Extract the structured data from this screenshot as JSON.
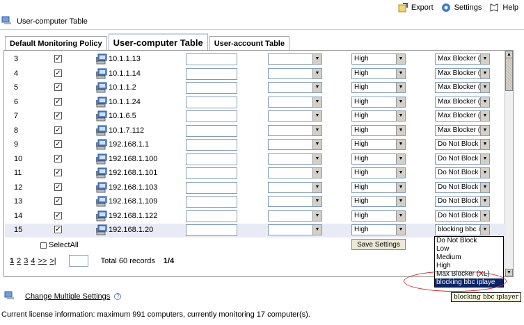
{
  "toolbar": {
    "export": "Export",
    "settings": "Settings",
    "help": "Help"
  },
  "page_title": "User-computer Table",
  "tabs": [
    "Default Monitoring Policy",
    "User-computer Table",
    "User-account Table"
  ],
  "rows": [
    {
      "num": "3",
      "checked": true,
      "ip": "10.1.1.13",
      "level": "High",
      "policy": "Max Blocker (X"
    },
    {
      "num": "4",
      "checked": true,
      "ip": "10.1.1.14",
      "level": "High",
      "policy": "Max Blocker (X"
    },
    {
      "num": "5",
      "checked": true,
      "ip": "10.1.1.2",
      "level": "High",
      "policy": "Max Blocker (X"
    },
    {
      "num": "6",
      "checked": true,
      "ip": "10.1.1.24",
      "level": "High",
      "policy": "Max Blocker (X"
    },
    {
      "num": "7",
      "checked": true,
      "ip": "10.1.6.5",
      "level": "High",
      "policy": "Max Blocker (X"
    },
    {
      "num": "8",
      "checked": true,
      "ip": "10.1.7.112",
      "level": "High",
      "policy": "Max Blocker (X"
    },
    {
      "num": "9",
      "checked": true,
      "ip": "192.168.1.1",
      "level": "High",
      "policy": "Do Not Block"
    },
    {
      "num": "10",
      "checked": true,
      "ip": "192.168.1.100",
      "level": "High",
      "policy": "Do Not Block"
    },
    {
      "num": "11",
      "checked": true,
      "ip": "192.168.1.101",
      "level": "High",
      "policy": "Do Not Block"
    },
    {
      "num": "12",
      "checked": true,
      "ip": "192.168.1.103",
      "level": "High",
      "policy": "Do Not Block"
    },
    {
      "num": "13",
      "checked": true,
      "ip": "192.168.1.109",
      "level": "High",
      "policy": "Do Not Block"
    },
    {
      "num": "14",
      "checked": true,
      "ip": "192.168.1.122",
      "level": "High",
      "policy": "Do Not Block"
    },
    {
      "num": "15",
      "checked": true,
      "ip": "192.168.1.20",
      "level": "High",
      "policy": "blocking bbc i",
      "selected": true
    }
  ],
  "select_all": "SelectAll",
  "save_button": "Save Settings",
  "pager": {
    "pages": [
      "1",
      "2",
      "3",
      "4"
    ],
    "next": ">>",
    "last": ">|",
    "total": "Total 60 records",
    "page_of": "1/4"
  },
  "dropdown_options": [
    "Do Not Block",
    "Low",
    "Medium",
    "High",
    "Max Blocker (XL)",
    "blocking bbc iplaye"
  ],
  "tooltip": "blocking bbc iplayer",
  "change_multiple": "Change Multiple Settings",
  "license": "Current license information: maximum 991 computers, currently monitoring 17 computer(s).",
  "colors": {
    "selected_row": "#e8eaf5",
    "highlight": "#0a246a",
    "ellipse": "#d42a2a",
    "tooltip_bg": "#ffffe1"
  }
}
